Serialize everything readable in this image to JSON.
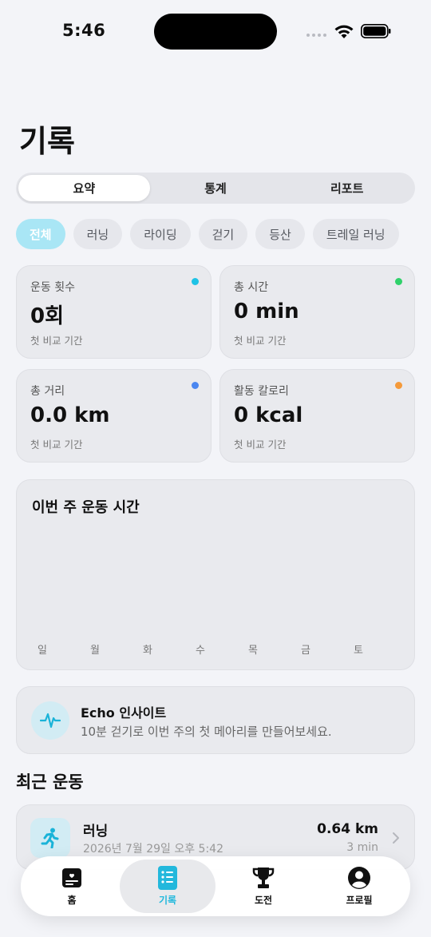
{
  "status": {
    "time": "5:46"
  },
  "page": {
    "title": "기록"
  },
  "segments": [
    {
      "label": "요약",
      "active": true
    },
    {
      "label": "통계",
      "active": false
    },
    {
      "label": "리포트",
      "active": false
    }
  ],
  "filters": [
    "전체",
    "러닝",
    "라이딩",
    "걷기",
    "등산",
    "트레일 러닝"
  ],
  "stats": [
    {
      "label": "운동 횟수",
      "value": "0회",
      "sub": "첫 비교 기간",
      "color": "#1ec3e6"
    },
    {
      "label": "총 시간",
      "value": "0 min",
      "sub": "첫 비교 기간",
      "color": "#2fd16a"
    },
    {
      "label": "총 거리",
      "value": "0.0 km",
      "sub": "첫 비교 기간",
      "color": "#4a86f0"
    },
    {
      "label": "활동 칼로리",
      "value": "0 kcal",
      "sub": "첫 비교 기간",
      "color": "#f59a3a"
    }
  ],
  "weekly": {
    "title": "이번 주 운동 시간",
    "days": [
      "일",
      "월",
      "화",
      "수",
      "목",
      "금",
      "토"
    ]
  },
  "insight": {
    "title": "Echo 인사이트",
    "text": "10분 걷기로 이번 주의 첫 메아리를 만들어보세요."
  },
  "recent": {
    "title": "최근 운동",
    "items": [
      {
        "name": "러닝",
        "date": "2026년 7월 29일 오후 5:42",
        "distance": "0.64 km",
        "duration": "3 min"
      }
    ]
  },
  "tabs": [
    {
      "label": "홈",
      "icon": "home-card-icon",
      "active": false
    },
    {
      "label": "기록",
      "icon": "list-icon",
      "active": true
    },
    {
      "label": "도전",
      "icon": "trophy-icon",
      "active": false
    },
    {
      "label": "프로필",
      "icon": "profile-icon",
      "active": false
    }
  ],
  "colors": {
    "accent": "#22b8dc",
    "chip_active": "#a9e6f5"
  }
}
